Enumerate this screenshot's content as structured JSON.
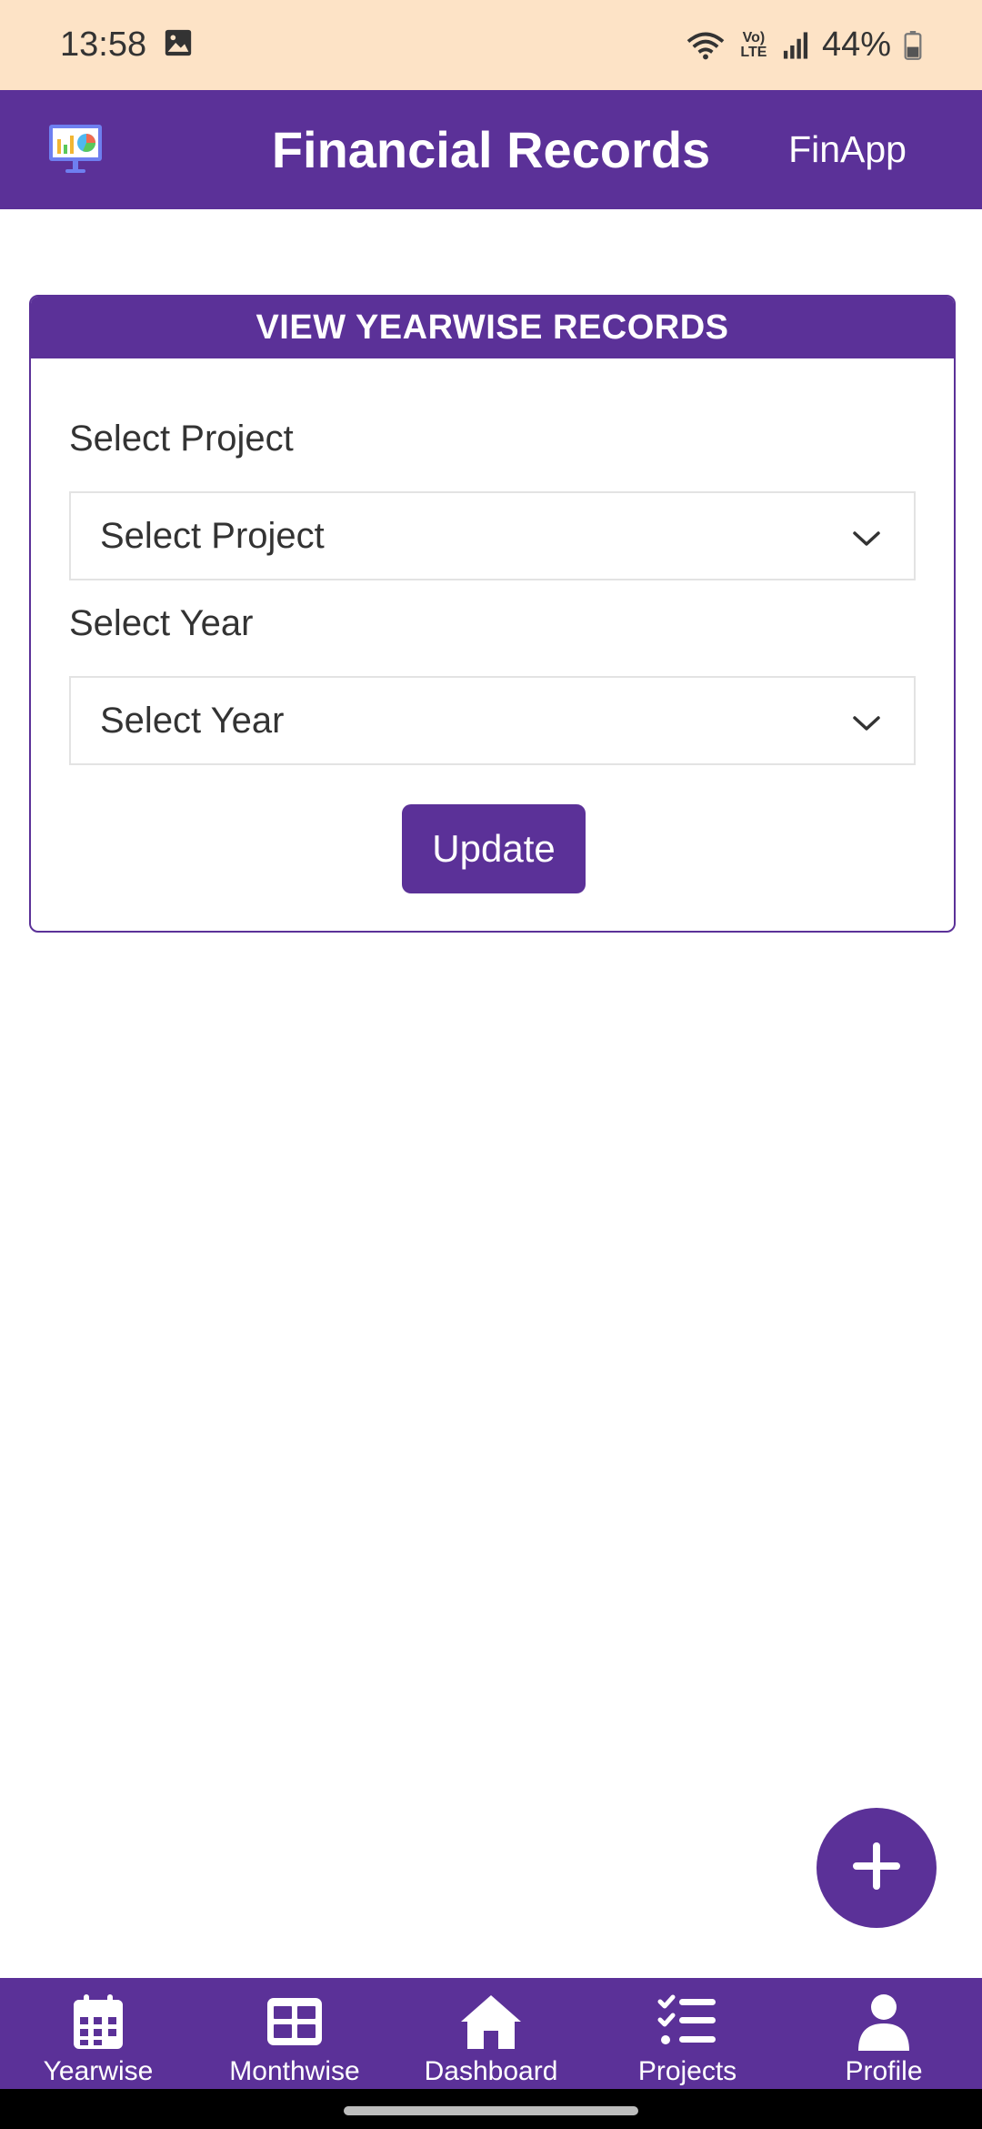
{
  "status_bar": {
    "time": "13:58",
    "battery_percent": "44%",
    "network_label": "Vo) LTE",
    "icons": [
      "gallery-icon",
      "wifi-icon",
      "volte-icon",
      "signal-icon",
      "battery-icon"
    ]
  },
  "app_bar": {
    "title": "Financial Records",
    "brand": "FinApp",
    "logo_icon": "presentation-chart-icon"
  },
  "card": {
    "header": "VIEW YEARWISE RECORDS",
    "project_label": "Select Project",
    "project_select_value": "Select Project",
    "year_label": "Select Year",
    "year_select_value": "Select Year",
    "update_label": "Update"
  },
  "fab": {
    "icon": "plus-icon"
  },
  "bottom_nav": {
    "items": [
      {
        "label": "Yearwise",
        "icon": "calendar-icon"
      },
      {
        "label": "Monthwise",
        "icon": "table-icon"
      },
      {
        "label": "Dashboard",
        "icon": "home-icon"
      },
      {
        "label": "Projects",
        "icon": "checklist-icon"
      },
      {
        "label": "Profile",
        "icon": "user-icon"
      }
    ]
  },
  "colors": {
    "primary": "#5b3198",
    "status_bar_bg": "#fde3c6",
    "background": "#ffffff",
    "text": "#333333"
  }
}
